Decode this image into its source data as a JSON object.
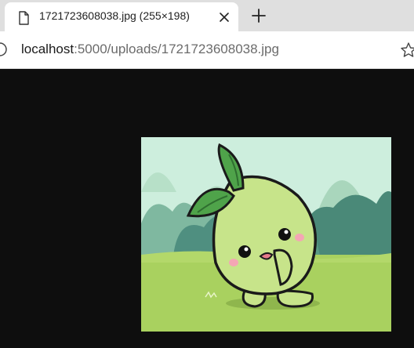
{
  "browser": {
    "tab": {
      "title": "1721723608038.jpg (255×198)",
      "icon": "document-icon",
      "close_icon": "close-icon"
    },
    "new_tab_icon": "plus-icon",
    "address": {
      "host": "localhost",
      "rest": ":5000/uploads/1721723608038.jpg",
      "info_icon": "info-icon",
      "bookmark_icon": "star-icon"
    }
  },
  "image": {
    "description": "cartoon green sprout character",
    "colors": {
      "sky": "#c9ecd9",
      "bushes": "#4f8f80",
      "grass": "#a9d15f",
      "body": "#c7e48a",
      "leaf": "#4fa34a",
      "background": "#0e0e0e"
    }
  }
}
